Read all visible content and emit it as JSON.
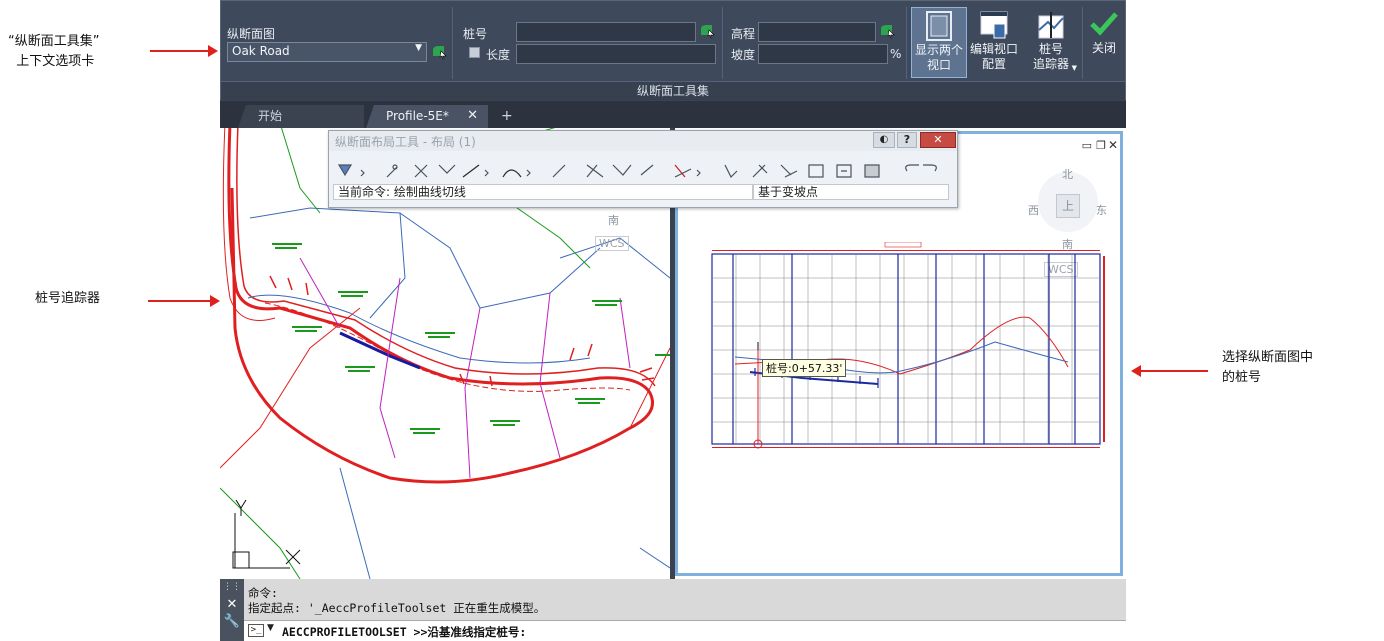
{
  "annotations": {
    "ribbon_callout": "“纵断面工具集”\n  上下文选项卡",
    "tracker_callout": "桩号追踪器",
    "station_callout": "选择纵断面图中\n的桩号"
  },
  "ribbon": {
    "profile_label": "纵断面图",
    "profile_value": "Oak Road",
    "station_label": "桩号",
    "length_label": "长度",
    "elevation_label": "高程",
    "grade_label": "坡度",
    "grade_unit": "%",
    "show_two_viewports": "显示两个\n视口",
    "edit_viewport_config": "编辑视口\n配置",
    "station_tracker": "桩号\n追踪器",
    "close": "关闭",
    "panel_title": "纵断面工具集"
  },
  "tabs": {
    "start": "开始",
    "profile": "Profile-5E*"
  },
  "layout_toolbar": {
    "title": "纵断面布局工具 - 布局 (1)",
    "current_command": "当前命令: 绘制曲线切线",
    "mode": "基于变坡点"
  },
  "viewcube": {
    "north": "北",
    "south": "南",
    "east": "东",
    "west": "西",
    "top": "上",
    "wcs": "WCS"
  },
  "left_view": {
    "south": "南",
    "wcs": "WCS",
    "ucs_y": "Y",
    "ucs_x": "X"
  },
  "profile_view": {
    "tooltip": "桩号:0+57.33'"
  },
  "command": {
    "line1": "命令:",
    "line2": "指定起点: '_AeccProfileToolset 正在重生成模型。",
    "prompt": "AECCPROFILETOOLSET >>沿基准线指定桩号:"
  },
  "colors": {
    "ribbon_bg": "#3e4a5b",
    "accent_green": "#22a04b",
    "alignment_red": "#e02020",
    "viewport_highlight": "#6fa8dc"
  }
}
